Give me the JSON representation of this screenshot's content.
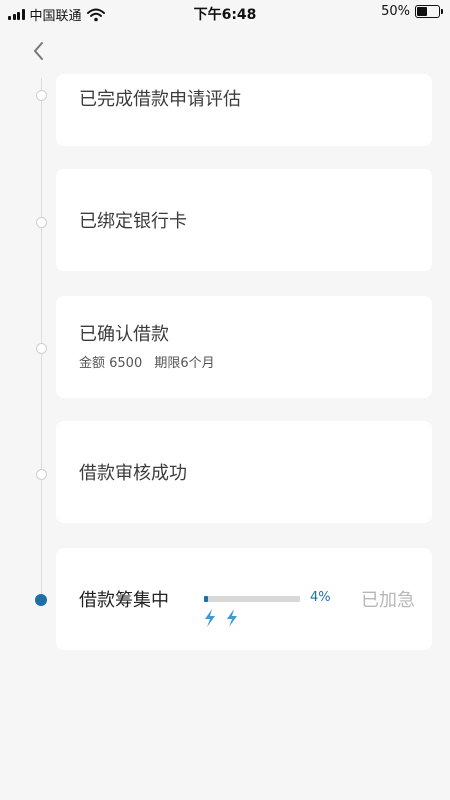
{
  "status_bar": {
    "carrier": "中国联通",
    "time": "下午6:48",
    "battery_percent": "50%",
    "battery_level": 0.5
  },
  "nav": {
    "back_icon": "chevron-left-icon"
  },
  "steps": [
    {
      "title": "已完成借款申请评估",
      "status": "completed"
    },
    {
      "title": "已绑定银行卡",
      "status": "completed"
    },
    {
      "title": "已确认借款",
      "status": "completed",
      "amount_label": "金额 6500",
      "term_label": "期限6个月"
    },
    {
      "title": "借款审核成功",
      "status": "completed"
    },
    {
      "title": "借款筹集中",
      "status": "active",
      "progress_label": "4%",
      "progress_value": 0.04,
      "speed_tag": "已加急",
      "bolt_icon": "lightning-bolt-icon",
      "bolt_count": 2
    }
  ],
  "colors": {
    "accent": "#1e6fa8",
    "muted": "#b7b7b7",
    "background": "#f6f6f7"
  }
}
